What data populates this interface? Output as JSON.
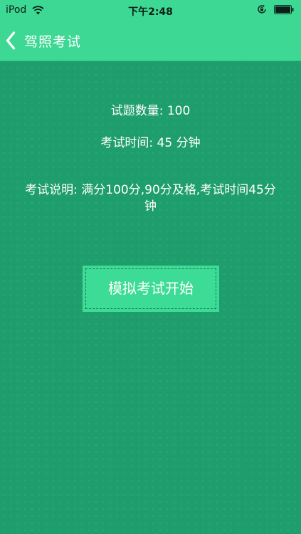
{
  "status_bar": {
    "carrier": "iPod",
    "time": "下午2:48"
  },
  "nav": {
    "title": "驾照考试"
  },
  "exam_info": {
    "question_count": "试题数量: 100",
    "exam_time": "考试时间: 45 分钟",
    "description": "考试说明: 满分100分,90分及格,考试时间45分钟"
  },
  "start_button": {
    "label": "模拟考试开始"
  },
  "colors": {
    "nav_bar": "#3dd894",
    "background": "#1e9e6c",
    "button": "#3ddc96"
  },
  "icons": {
    "wifi": "wifi-icon",
    "rotation_lock": "rotation-lock-icon",
    "battery": "battery-icon",
    "back": "chevron-left-icon"
  }
}
